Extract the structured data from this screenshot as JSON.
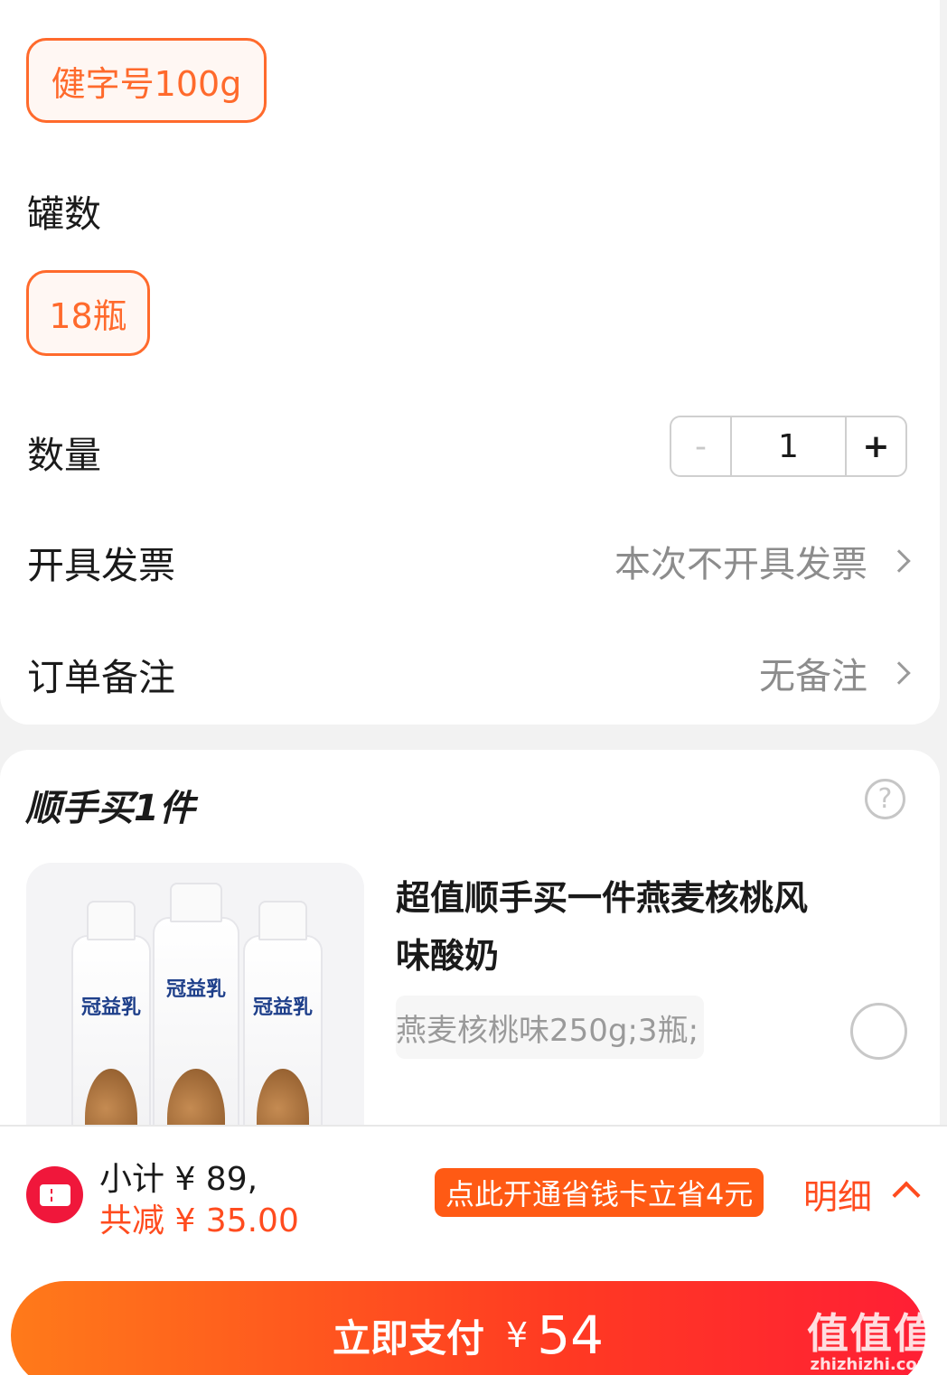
{
  "spec": {
    "size_option": "健字号100g",
    "cans_label": "罐数",
    "count_option": "18瓶"
  },
  "quantity": {
    "label": "数量",
    "minus": "-",
    "value": "1",
    "plus": "+"
  },
  "invoice": {
    "label": "开具发票",
    "value": "本次不开具发票"
  },
  "remark": {
    "label": "订单备注",
    "value": "无备注"
  },
  "addon": {
    "title": "顺手买1件",
    "help_icon": "?",
    "product": {
      "title": "超值顺手买一件燕麦核桃风味酸奶",
      "spec": "燕麦核桃味250g;3瓶;",
      "image_brand": "冠益乳"
    }
  },
  "footer": {
    "subtotal": "小计 ¥ 89,",
    "discount": "共减 ¥ 35.00",
    "promo": "点此开通省钱卡立省4元",
    "detail": "明细",
    "pay_label": "立即支付",
    "currency": "¥",
    "pay_amount": "54"
  },
  "watermark": {
    "big": "值值值",
    "small": "zhizhizhi.com"
  },
  "colors": {
    "accent": "#ff6a2c",
    "price_red": "#ff4c1f",
    "coupon_red": "#f0173b"
  }
}
